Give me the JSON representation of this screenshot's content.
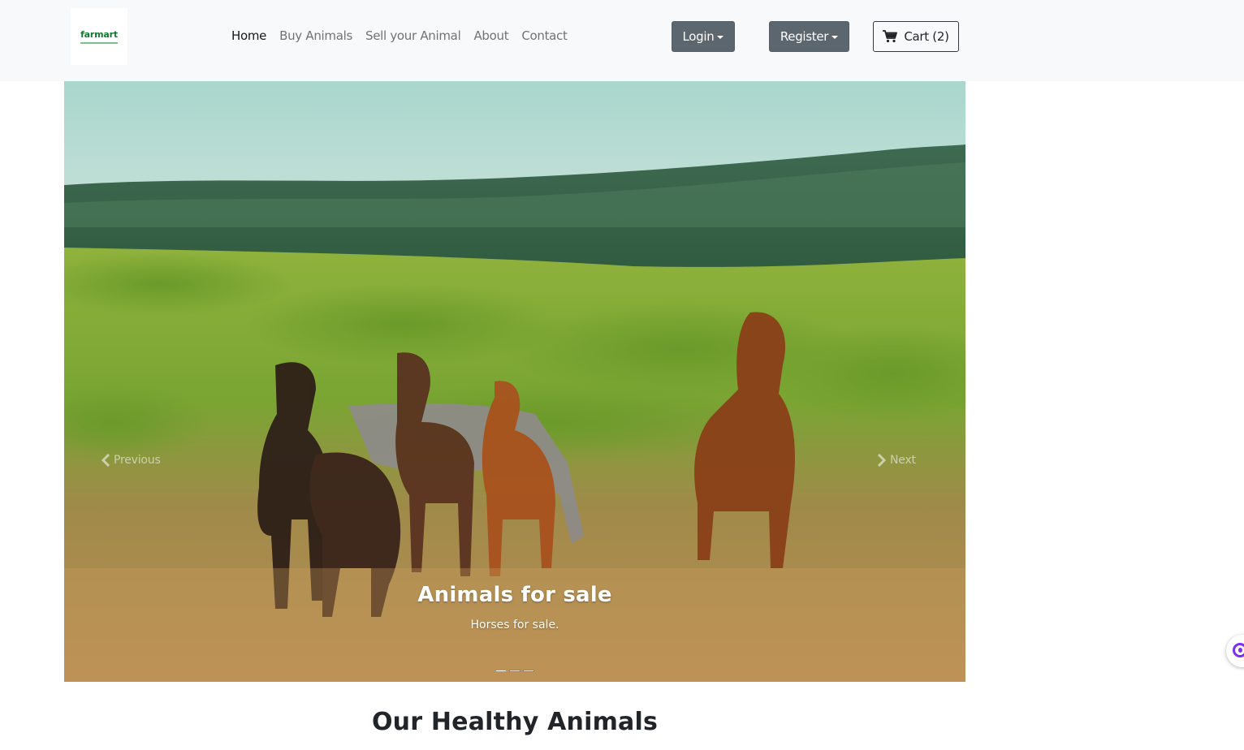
{
  "brand": {
    "name": "farmart",
    "tagline_color": "#7fbf8c",
    "color": "#0f7a2e"
  },
  "nav": {
    "links": [
      {
        "label": "Home",
        "active": true
      },
      {
        "label": "Buy Animals",
        "active": false
      },
      {
        "label": "Sell your Animal",
        "active": false
      },
      {
        "label": "About",
        "active": false
      },
      {
        "label": "Contact",
        "active": false
      }
    ],
    "login_label": "Login",
    "register_label": "Register",
    "cart_label": "Cart (2)",
    "cart_icon": "cart-icon"
  },
  "carousel": {
    "prev_label": "Previous",
    "next_label": "Next",
    "caption_title": "Animals for sale",
    "caption_text": "Horses for sale.",
    "slide_count": 3,
    "active_slide": 1
  },
  "section": {
    "title": "Our Healthy Animals"
  },
  "colors": {
    "navbar_bg": "#f8f9fa",
    "button_secondary": "#5c666f",
    "widget_accent": "#7b2ff7"
  }
}
